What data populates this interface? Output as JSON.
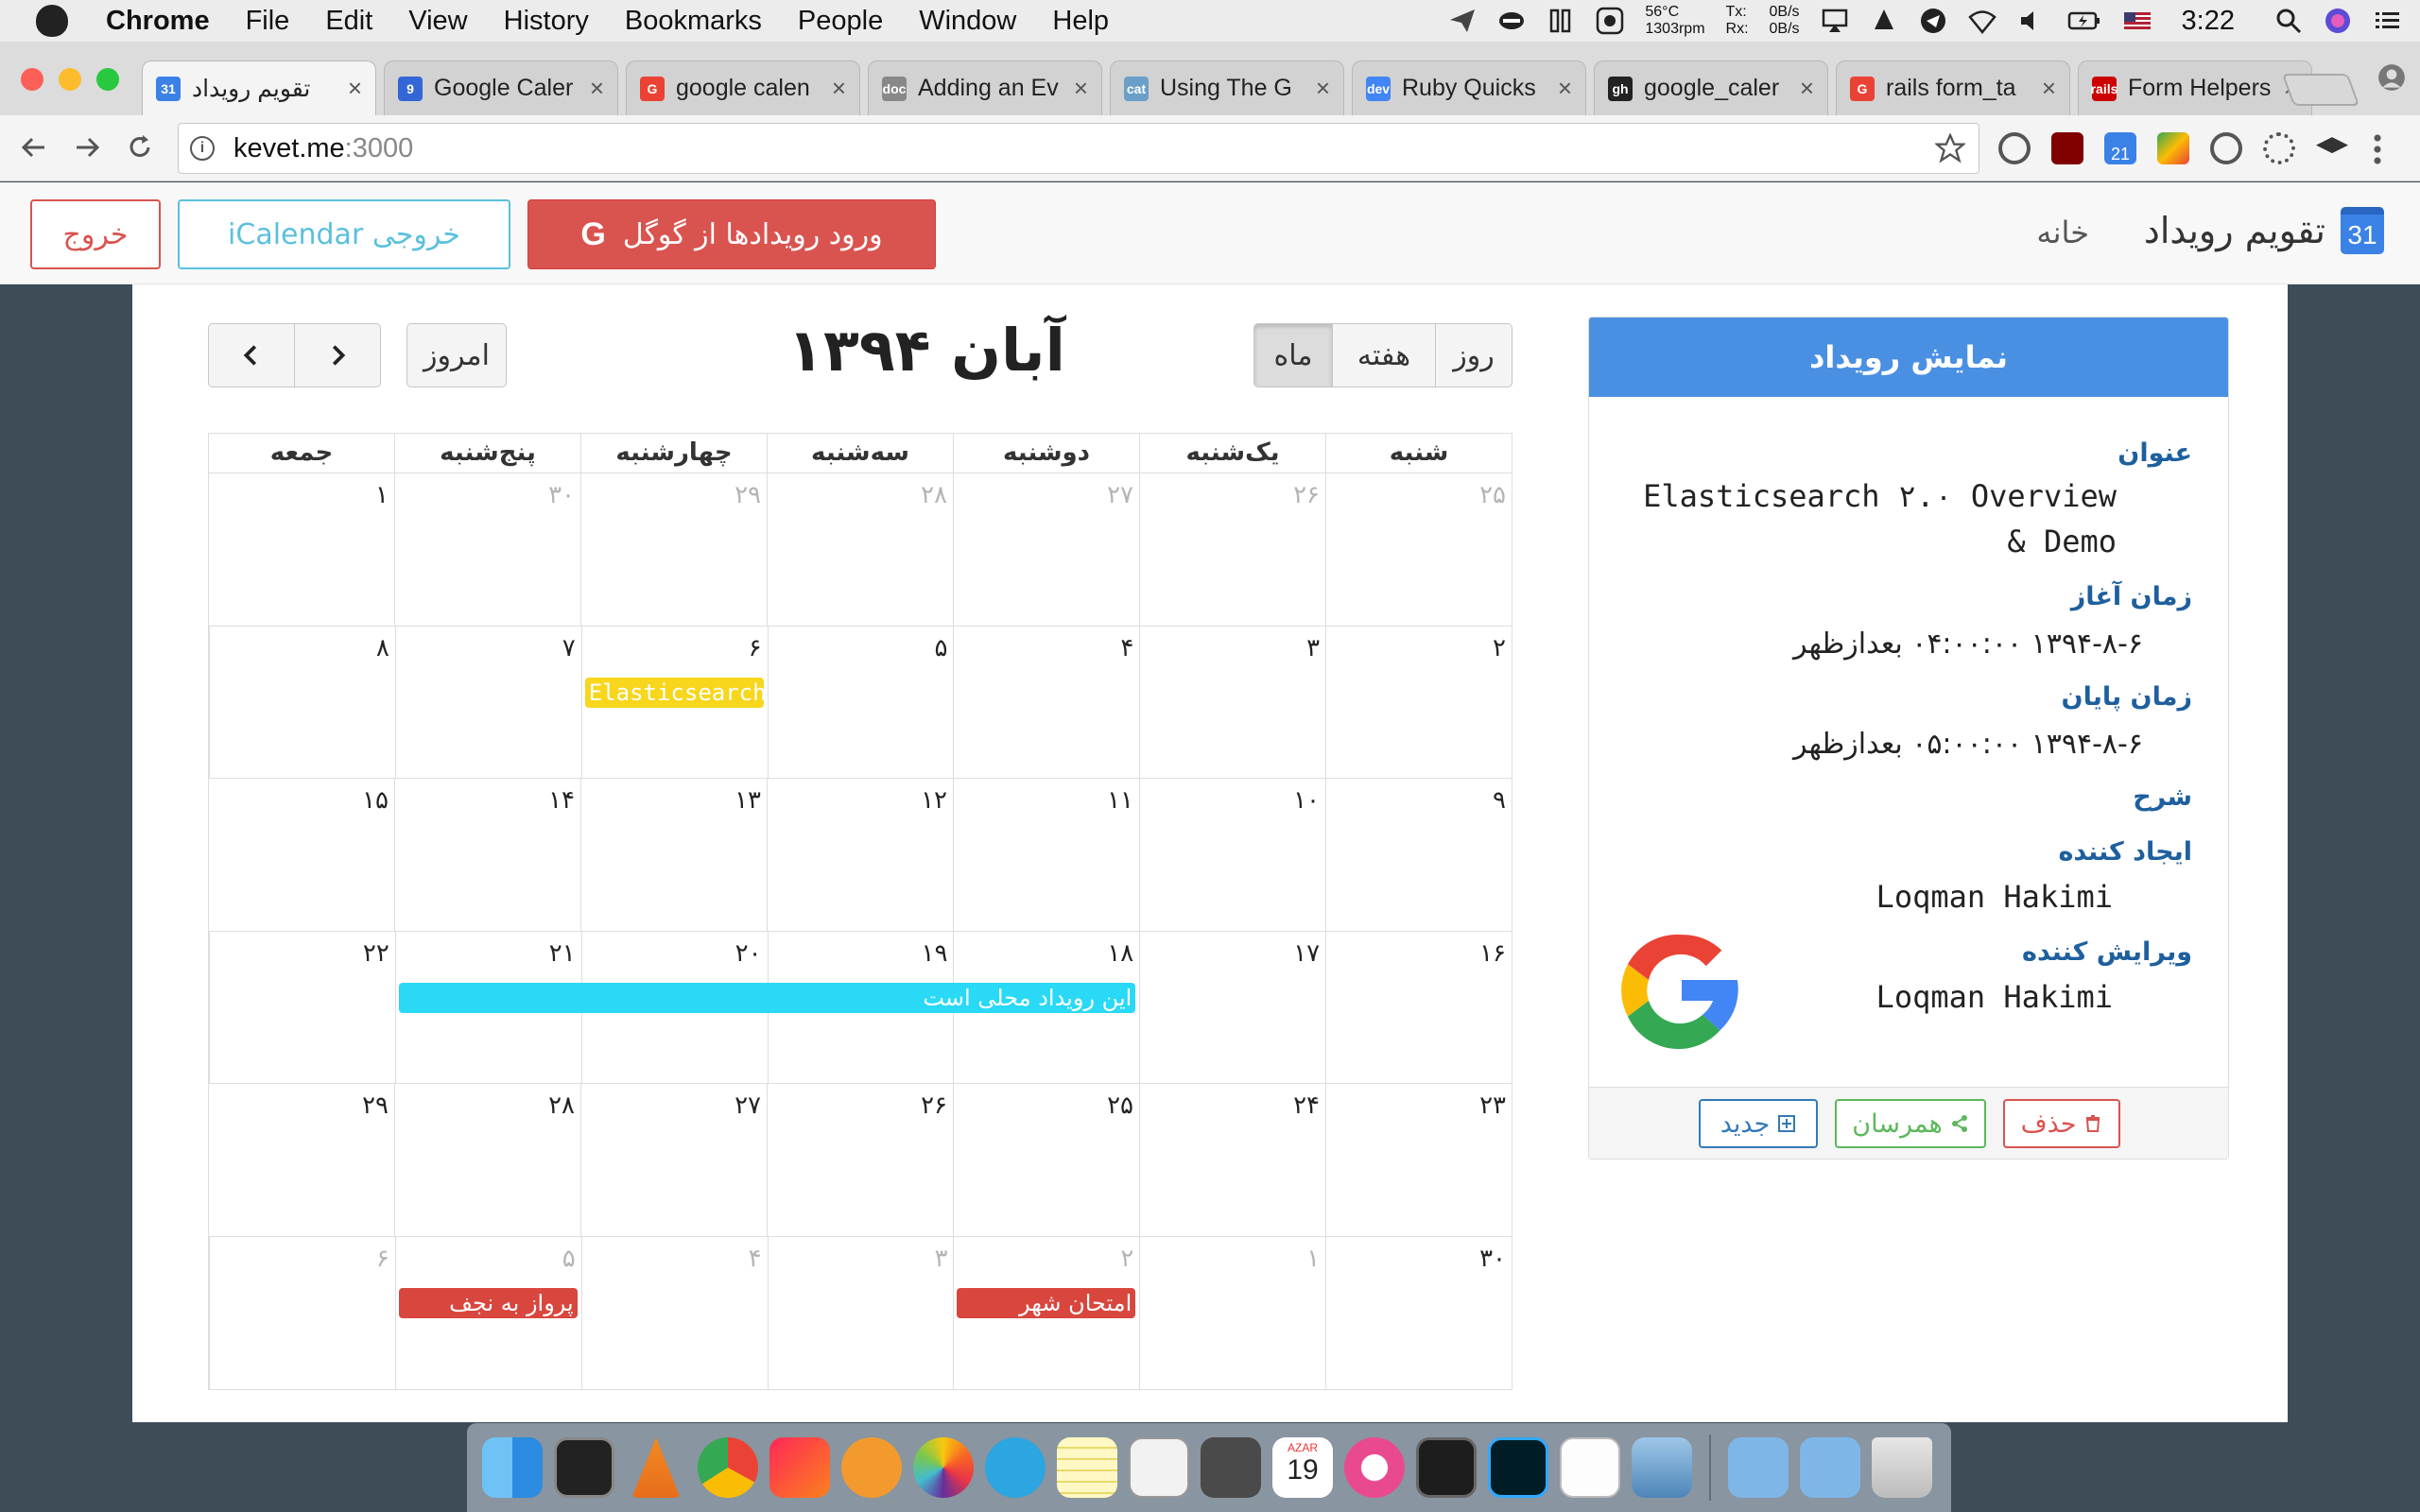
{
  "menubar": {
    "app_name": "Chrome",
    "items": [
      "File",
      "Edit",
      "View",
      "History",
      "Bookmarks",
      "People",
      "Window",
      "Help"
    ],
    "temp": "56°C",
    "rpm": "1303rpm",
    "tx_label": "Tx:",
    "rx_label": "Rx:",
    "tx_value": "0B/s",
    "rx_value": "0B/s",
    "clock": "3:22"
  },
  "tabs": [
    {
      "title": "تقویم رویداد",
      "favicon": "31",
      "color": "#3b82e6",
      "active": true
    },
    {
      "title": "Google Caler",
      "favicon": "9",
      "color": "#3367d6",
      "active": false
    },
    {
      "title": "google calen",
      "favicon": "G",
      "color": "#ea4335",
      "active": false
    },
    {
      "title": "Adding an Ev",
      "favicon": "doc",
      "color": "#888888",
      "active": false
    },
    {
      "title": "Using The G",
      "favicon": "cat",
      "color": "#6aa0c8",
      "active": false
    },
    {
      "title": "Ruby Quicks",
      "favicon": "dev",
      "color": "#4285f4",
      "active": false
    },
    {
      "title": "google_caler",
      "favicon": "gh",
      "color": "#222222",
      "active": false
    },
    {
      "title": "rails form_ta",
      "favicon": "G",
      "color": "#ea4335",
      "active": false
    },
    {
      "title": "Form Helpers",
      "favicon": "rails",
      "color": "#cc0000",
      "active": false
    }
  ],
  "address": {
    "host": "kevet.me",
    "port": ":3000"
  },
  "navbar": {
    "brand_icon": "31",
    "brand": "تقویم رویداد",
    "home": "خانه",
    "google_btn": "ورود رویدادها از گوگل",
    "google_btn_icon": "G",
    "ical_btn": "خروجی iCalendar",
    "exit_btn": "خروج"
  },
  "event_panel": {
    "heading": "نمایش رویداد",
    "title_label": "عنوان",
    "title_value_1": "Elasticsearch ۲.۰ Overview",
    "title_value_2": "& Demo",
    "start_label": "زمان آغاز",
    "start_value": "۱۳۹۴-۸-۶ ۰۴:۰۰:۰۰ بعدازظهر",
    "end_label": "زمان پایان",
    "end_value": "۱۳۹۴-۸-۶ ۰۵:۰۰:۰۰ بعدازظهر",
    "desc_label": "شرح",
    "creator_label": "ایجاد کننده",
    "creator_value": "Loqman Hakimi",
    "editor_label": "ویرایش کننده",
    "editor_value": "Loqman Hakimi",
    "delete_btn": "حذف",
    "share_btn": "همرسان",
    "new_btn": "جدید"
  },
  "calendar": {
    "title": "آبان ۱۳۹۴",
    "today_btn": "امروز",
    "views": {
      "day": "روز",
      "week": "هفته",
      "month": "ماه"
    },
    "active_view": "month",
    "weekdays": [
      "شنبه",
      "یک‌شنبه",
      "دوشنبه",
      "سه‌شنبه",
      "چهارشنبه",
      "پنج‌شنبه",
      "جمعه"
    ],
    "weeks": [
      [
        {
          "n": "۲۵",
          "o": true
        },
        {
          "n": "۲۶",
          "o": true
        },
        {
          "n": "۲۷",
          "o": true
        },
        {
          "n": "۲۸",
          "o": true
        },
        {
          "n": "۲۹",
          "o": true
        },
        {
          "n": "۳۰",
          "o": true
        },
        {
          "n": "۱",
          "o": false
        }
      ],
      [
        {
          "n": "۲",
          "o": false
        },
        {
          "n": "۳",
          "o": false
        },
        {
          "n": "۴",
          "o": false
        },
        {
          "n": "۵",
          "o": false
        },
        {
          "n": "۶",
          "o": false
        },
        {
          "n": "۷",
          "o": false
        },
        {
          "n": "۸",
          "o": false
        }
      ],
      [
        {
          "n": "۹",
          "o": false
        },
        {
          "n": "۱۰",
          "o": false
        },
        {
          "n": "۱۱",
          "o": false
        },
        {
          "n": "۱۲",
          "o": false
        },
        {
          "n": "۱۳",
          "o": false
        },
        {
          "n": "۱۴",
          "o": false
        },
        {
          "n": "۱۵",
          "o": false
        }
      ],
      [
        {
          "n": "۱۶",
          "o": false
        },
        {
          "n": "۱۷",
          "o": false
        },
        {
          "n": "۱۸",
          "o": false
        },
        {
          "n": "۱۹",
          "o": false
        },
        {
          "n": "۲۰",
          "o": false
        },
        {
          "n": "۲۱",
          "o": false
        },
        {
          "n": "۲۲",
          "o": false
        }
      ],
      [
        {
          "n": "۲۳",
          "o": false
        },
        {
          "n": "۲۴",
          "o": false
        },
        {
          "n": "۲۵",
          "o": false
        },
        {
          "n": "۲۶",
          "o": false
        },
        {
          "n": "۲۷",
          "o": false
        },
        {
          "n": "۲۸",
          "o": false
        },
        {
          "n": "۲۹",
          "o": false
        }
      ],
      [
        {
          "n": "۳۰",
          "o": false
        },
        {
          "n": "۱",
          "o": true
        },
        {
          "n": "۲",
          "o": true
        },
        {
          "n": "۳",
          "o": true
        },
        {
          "n": "۴",
          "o": true
        },
        {
          "n": "۵",
          "o": true
        },
        {
          "n": "۶",
          "o": true
        }
      ]
    ],
    "events": {
      "elastic": "Elasticsearch",
      "local": "این رویداد محلی است",
      "exam": "امتحان شهر",
      "flight": "پرواز به نجف"
    }
  },
  "colors": {
    "accent": "#4a90e2",
    "danger": "#d9534f",
    "info": "#5bc0de",
    "success": "#5cb85c",
    "primary": "#337ab7"
  },
  "dock_calendar_month": "AZAR",
  "dock_calendar_day": "19"
}
